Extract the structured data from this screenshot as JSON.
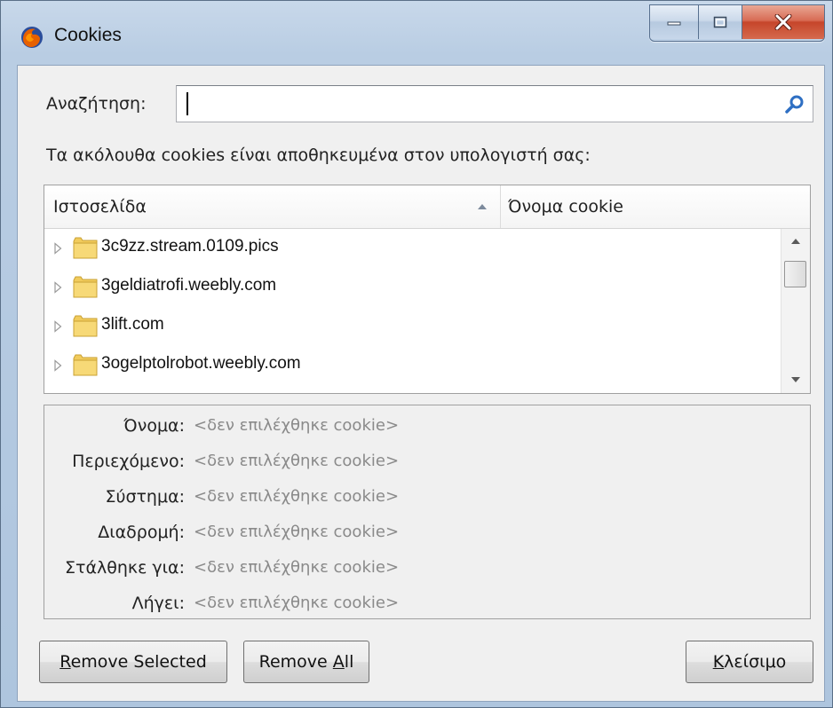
{
  "window": {
    "title": "Cookies",
    "icon": "firefox-icon",
    "controls": [
      "minimize-icon",
      "maximize-icon",
      "close-icon"
    ]
  },
  "search": {
    "label": "Αναζήτηση:",
    "value": "",
    "icon": "search-icon"
  },
  "description": "Τα ακόλουθα cookies είναι αποθηκευμένα στον υπολογιστή σας:",
  "tree": {
    "columns": [
      {
        "label": "Ιστοσελίδα",
        "sorted": "ascending"
      },
      {
        "label": "Όνομα cookie"
      }
    ],
    "rows": [
      {
        "site": "3c9zz.stream.0109.pics"
      },
      {
        "site": "3geldiatrofi.weebly.com"
      },
      {
        "site": "3lift.com"
      },
      {
        "site": "3ogelptolrobot.weebly.com"
      }
    ]
  },
  "details": [
    {
      "label": "Όνομα:",
      "value": "<δεν επιλέχθηκε cookie>"
    },
    {
      "label": "Περιεχόμενο:",
      "value": "<δεν επιλέχθηκε cookie>"
    },
    {
      "label": "Σύστημα:",
      "value": "<δεν επιλέχθηκε cookie>"
    },
    {
      "label": "Διαδρομή:",
      "value": "<δεν επιλέχθηκε cookie>"
    },
    {
      "label": "Στάλθηκε για:",
      "value": "<δεν επιλέχθηκε cookie>"
    },
    {
      "label": "Λήγει:",
      "value": "<δεν επιλέχθηκε cookie>"
    }
  ],
  "buttons": {
    "remove_selected": {
      "mnemonic": "R",
      "rest": "emove Selected"
    },
    "remove_all": {
      "prefix": "Remove ",
      "mnemonic": "A",
      "rest": "ll"
    },
    "close": {
      "mnemonic": "Κ",
      "rest": "λείσιμο"
    }
  }
}
